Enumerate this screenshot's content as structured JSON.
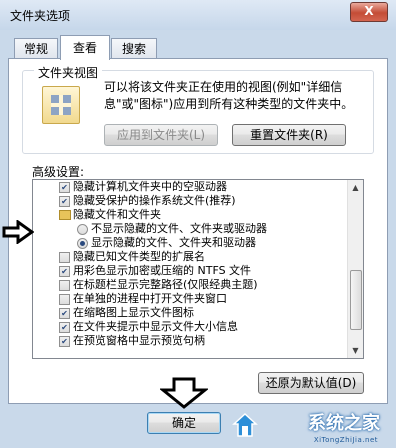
{
  "window": {
    "title": "文件夹选项",
    "close_glyph": "X"
  },
  "tabs": [
    {
      "label": "常规"
    },
    {
      "label": "查看",
      "active": true
    },
    {
      "label": "搜索"
    }
  ],
  "folder_views": {
    "legend": "文件夹视图",
    "description": "可以将该文件夹正在使用的视图(例如\"详细信息\"或\"图标\")应用到所有这种类型的文件夹中。",
    "apply_button": "应用到文件夹(L)",
    "reset_button": "重置文件夹(R)"
  },
  "advanced": {
    "label": "高级设置:",
    "items": [
      {
        "type": "checkbox",
        "checked": true,
        "label": "隐藏计算机文件夹中的空驱动器"
      },
      {
        "type": "checkbox",
        "checked": true,
        "label": "隐藏受保护的操作系统文件(推荐)"
      },
      {
        "type": "folder",
        "label": "隐藏文件和文件夹"
      },
      {
        "type": "radio",
        "selected": false,
        "label": "不显示隐藏的文件、文件夹或驱动器"
      },
      {
        "type": "radio",
        "selected": true,
        "label": "显示隐藏的文件、文件夹和驱动器"
      },
      {
        "type": "checkbox",
        "checked": false,
        "label": "隐藏已知文件类型的扩展名"
      },
      {
        "type": "checkbox",
        "checked": true,
        "label": "用彩色显示加密或压缩的 NTFS 文件"
      },
      {
        "type": "checkbox",
        "checked": false,
        "label": "在标题栏显示完整路径(仅限经典主题)"
      },
      {
        "type": "checkbox",
        "checked": false,
        "label": "在单独的进程中打开文件夹窗口"
      },
      {
        "type": "checkbox",
        "checked": true,
        "label": "在缩略图上显示文件图标"
      },
      {
        "type": "checkbox",
        "checked": true,
        "label": "在文件夹提示中显示文件大小信息"
      },
      {
        "type": "checkbox",
        "checked": true,
        "label": "在预览窗格中显示预览句柄"
      }
    ],
    "restore_button": "还原为默认值(D)"
  },
  "footer": {
    "ok_button": "确定"
  },
  "watermark": {
    "brand": "系统之家",
    "url": "XiTongZhiJia.net"
  },
  "colors": {
    "accent": "#3c7fb1",
    "window_frame": "#c9d9ea",
    "close_red": "#c44c36"
  }
}
